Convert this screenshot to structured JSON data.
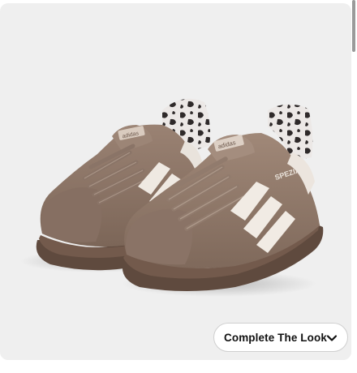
{
  "product": {
    "image_alt": "Brown suede sneakers with white stripes and animal print lining",
    "shoe_brand_text": "adidas",
    "shoe_model_text": "SPEZIAL"
  },
  "actions": {
    "complete_look_label": "Complete The Look",
    "complete_look_icon": "chevron-down-icon"
  },
  "colors": {
    "background": "#efefef",
    "suede": "#8b7467",
    "stripes": "#efe9e2",
    "gum_sole": "#6b5548"
  }
}
